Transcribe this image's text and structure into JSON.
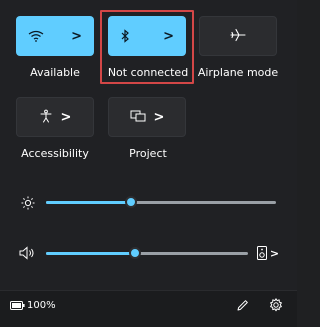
{
  "quick_settings": {
    "tiles": [
      {
        "id": "wifi",
        "label": "Available",
        "state": "on",
        "icon": "wifi-icon"
      },
      {
        "id": "bluetooth",
        "label": "Not connected",
        "state": "on",
        "icon": "bluetooth-icon"
      },
      {
        "id": "airplane",
        "label": "Airplane mode",
        "state": "off",
        "icon": "airplane-icon"
      },
      {
        "id": "accessibility",
        "label": "Accessibility",
        "state": "off",
        "icon": "accessibility-icon"
      },
      {
        "id": "project",
        "label": "Project",
        "state": "off",
        "icon": "project-icon"
      }
    ],
    "chevron": ">"
  },
  "sliders": {
    "brightness": {
      "level_percent": 37,
      "icon": "brightness-icon"
    },
    "volume": {
      "level_percent": 44,
      "icon": "speaker-icon",
      "output_icon": "speaker-device-icon"
    }
  },
  "footer": {
    "battery_text": "100%",
    "battery_icon": "battery-icon",
    "edit_icon": "pencil-icon",
    "settings_icon": "gear-icon"
  },
  "colors": {
    "accent": "#60cdff",
    "highlight": "#d34747",
    "background": "#202124"
  }
}
